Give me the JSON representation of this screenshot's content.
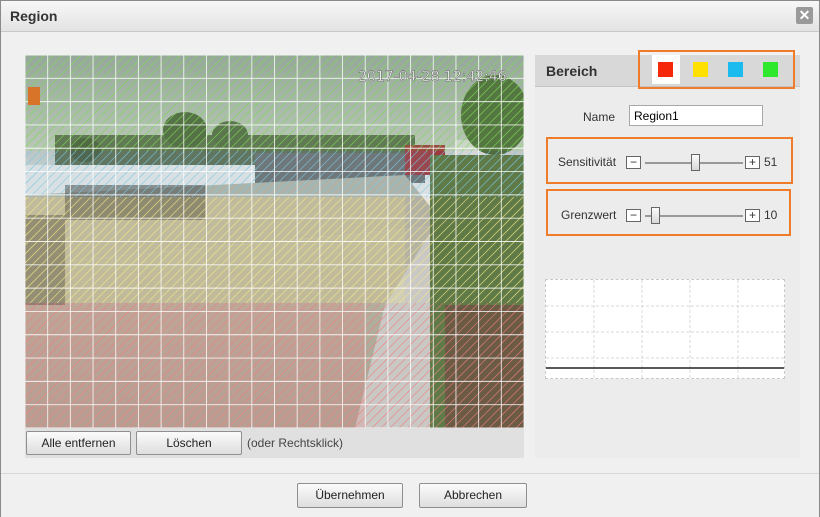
{
  "window": {
    "title": "Region",
    "close_glyph": "✕",
    "close_icon": "close-icon"
  },
  "video": {
    "timestamp": "2017-04-28 12:42:46",
    "grid_cols": 22,
    "grid_rows": 16,
    "region_colors": {
      "green": "#7ed957",
      "blue": "#7ec8e3",
      "yellow": "#f3e889",
      "red": "#f08080"
    }
  },
  "toolbar": {
    "remove_all_label": "Alle entfernen",
    "delete_label": "Löschen",
    "hint": "(oder Rechtsklick)"
  },
  "side": {
    "title": "Bereich",
    "colors": [
      {
        "name": "red",
        "hex": "#f5280a",
        "active": true
      },
      {
        "name": "yellow",
        "hex": "#ffe000",
        "active": false
      },
      {
        "name": "cyan",
        "hex": "#1bbbf0",
        "active": false
      },
      {
        "name": "green",
        "hex": "#2ee82e",
        "active": false
      }
    ],
    "name_label": "Name",
    "name_value": "Region1",
    "sensitivity": {
      "label": "Sensitivität",
      "value": "51",
      "minus": "−",
      "plus": "+",
      "fraction": 0.51
    },
    "threshold": {
      "label": "Grenzwert",
      "value": "10",
      "minus": "−",
      "plus": "+",
      "fraction": 0.1
    }
  },
  "footer": {
    "apply_label": "Übernehmen",
    "cancel_label": "Abbrechen"
  },
  "accent": "#ee7c2b"
}
